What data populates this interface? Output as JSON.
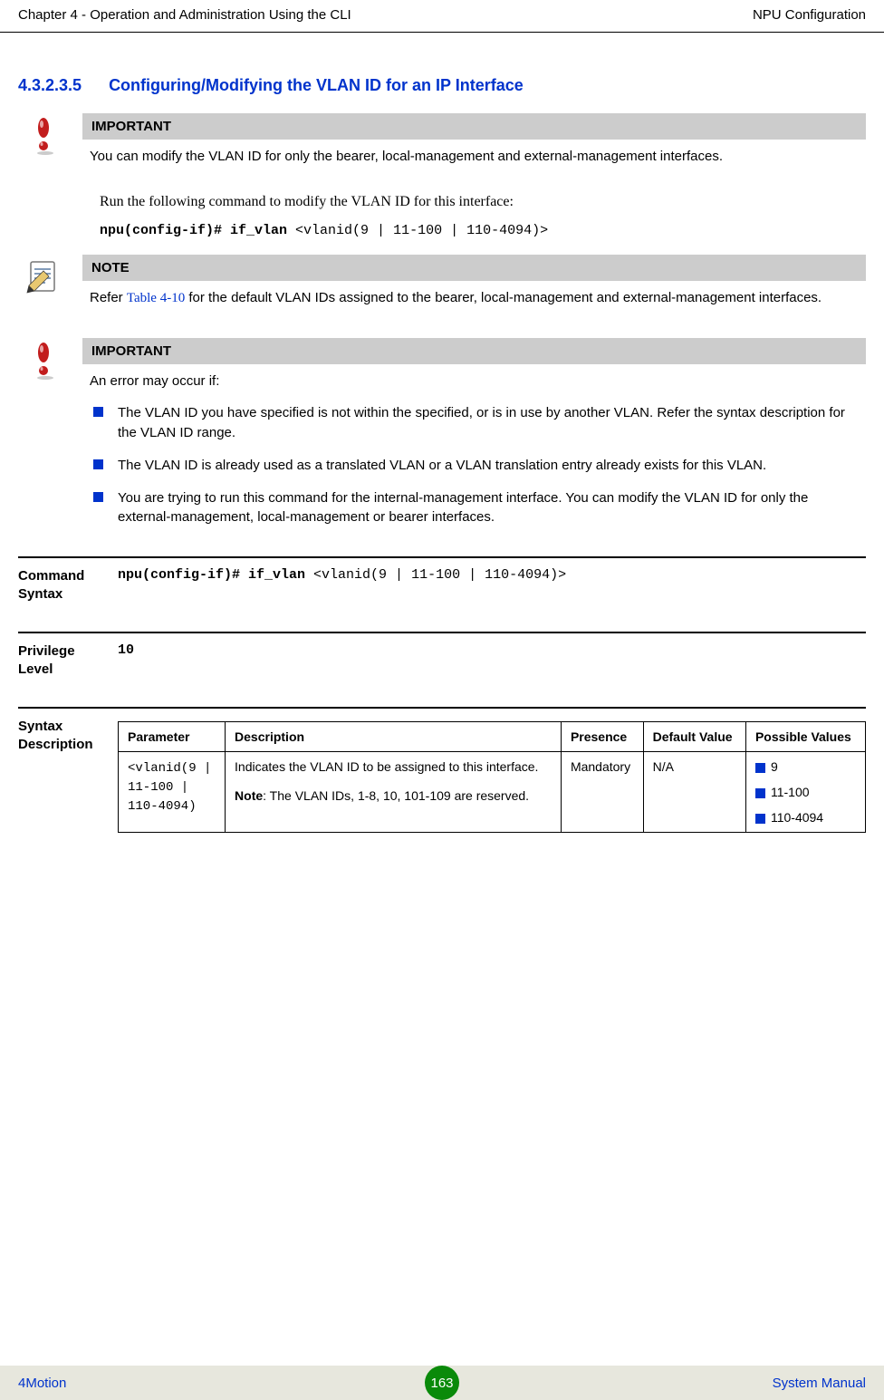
{
  "header": {
    "left": "Chapter 4 - Operation and Administration Using the CLI",
    "right": "NPU Configuration"
  },
  "section": {
    "number": "4.3.2.3.5",
    "title": "Configuring/Modifying the VLAN ID for an IP Interface"
  },
  "callout1": {
    "label": "IMPORTANT",
    "text": "You can modify the VLAN ID for only the bearer, local-management and external-management interfaces."
  },
  "body1": "Run the following command to modify the VLAN ID for this interface:",
  "cmd1": {
    "bold": "npu(config-if)# if_vlan ",
    "rest": "<vlanid(9 | 11-100 | 110-4094)>"
  },
  "note": {
    "label": "NOTE",
    "prefix": "Refer ",
    "ref": "Table 4-10",
    "suffix": " for the default VLAN IDs assigned to the bearer, local-management and external-management interfaces."
  },
  "callout2": {
    "label": "IMPORTANT",
    "intro": "An error may occur if:",
    "bullets": [
      "The VLAN ID you have specified is not within the specified, or is in use by another VLAN. Refer the syntax description for the VLAN ID range.",
      "The VLAN ID is already used as a translated VLAN or a VLAN translation entry already exists for this VLAN.",
      "You are trying to run this command for the internal-management interface. You can modify the VLAN ID for only the external-management, local-management or bearer interfaces."
    ]
  },
  "defs": {
    "cmdSyntax": {
      "label": "Command Syntax",
      "bold": "npu(config-if)# if_vlan ",
      "rest": "<vlanid(9 | 11-100 | 110-4094)>"
    },
    "privLevel": {
      "label": "Privilege Level",
      "value": "10"
    },
    "syntaxDesc": {
      "label": "Syntax Description",
      "headers": {
        "p": "Parameter",
        "d": "Description",
        "pr": "Presence",
        "dv": "Default Value",
        "pv": "Possible Values"
      },
      "row": {
        "param": "<vlanid(9 |\n11-100 |\n110-4094)",
        "desc1": "Indicates the VLAN ID to be assigned to this interface.",
        "desc2_label": "Note",
        "desc2_rest": ": The VLAN IDs, 1-8, 10, 101-109 are reserved.",
        "presence": "Mandatory",
        "default": "N/A",
        "pv": [
          "9",
          "11-100",
          "110-4094"
        ]
      }
    }
  },
  "footer": {
    "left": "4Motion",
    "page": "163",
    "right": "System Manual"
  }
}
